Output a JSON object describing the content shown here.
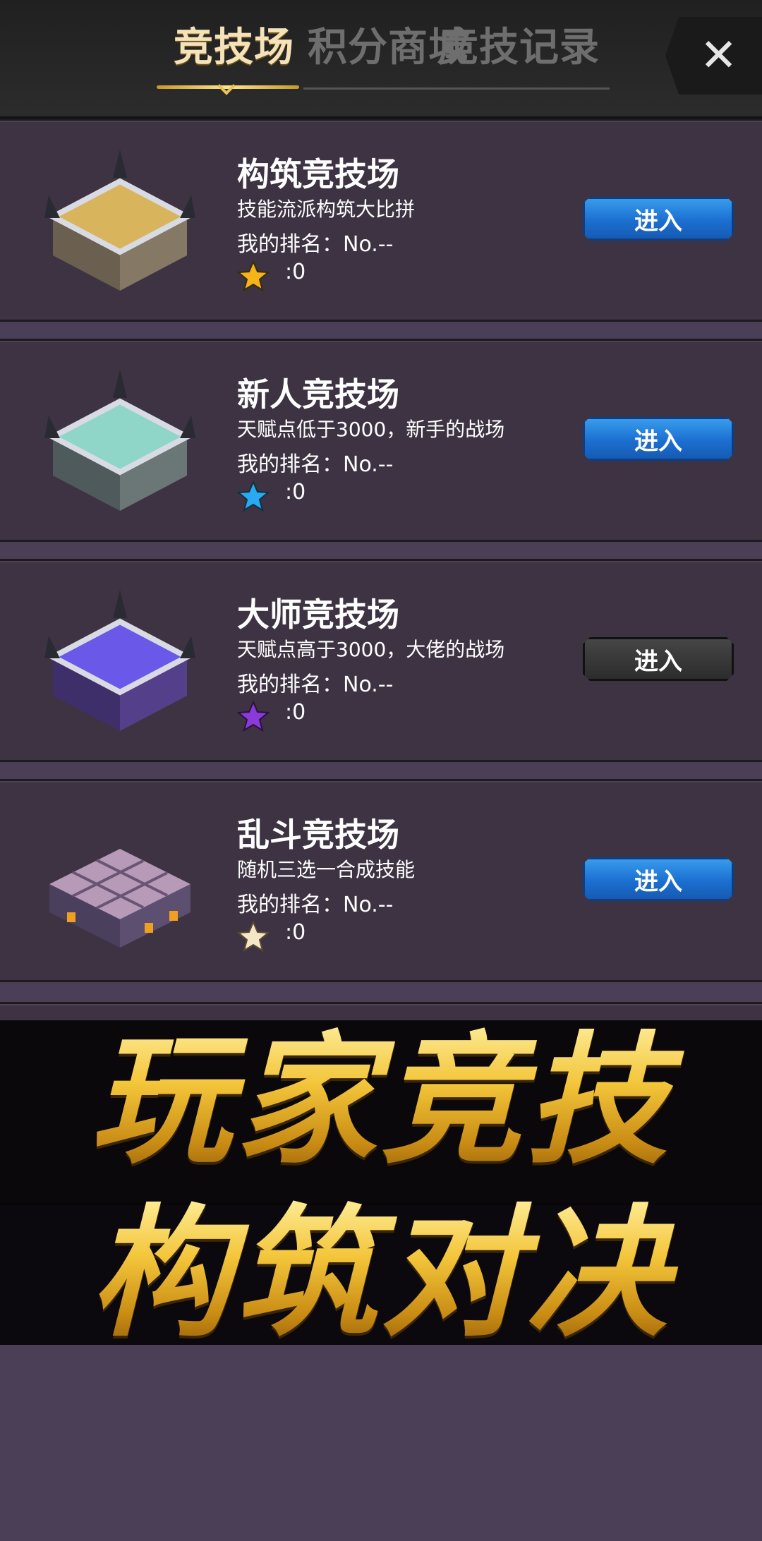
{
  "header": {
    "tabs": [
      {
        "label": "竞技场",
        "active": true
      },
      {
        "label": "积分商城",
        "active": false
      },
      {
        "label": "竞技记录",
        "active": false
      }
    ],
    "close_label": "✕"
  },
  "arenas": [
    {
      "title": "构筑竞技场",
      "desc": "技能流派构筑大比拼",
      "rank": "我的排名：No.--",
      "stars": ":0",
      "star_color": "#f5b41a",
      "gem_color": "#d8b45c",
      "enter": "进入",
      "enabled": true
    },
    {
      "title": "新人竞技场",
      "desc": "天赋点低于3000，新手的战场",
      "rank": "我的排名：No.--",
      "stars": ":0",
      "star_color": "#2aa8f0",
      "gem_color": "#8fd6c8",
      "enter": "进入",
      "enabled": true
    },
    {
      "title": "大师竞技场",
      "desc": "天赋点高于3000，大佬的战场",
      "rank": "我的排名：No.--",
      "stars": ":0",
      "star_color": "#8a3ad8",
      "gem_color": "#6a58e8",
      "enter": "进入",
      "enabled": false
    },
    {
      "title": "乱斗竞技场",
      "desc": "随机三选一合成技能",
      "rank": "我的排名：No.--",
      "stars": ":0",
      "star_color": "#f4e6c6",
      "gem_color": "#b69ab8",
      "enter": "进入",
      "enabled": true
    }
  ],
  "banner": {
    "line1": "玩家竞技",
    "line2": "构筑对决"
  }
}
